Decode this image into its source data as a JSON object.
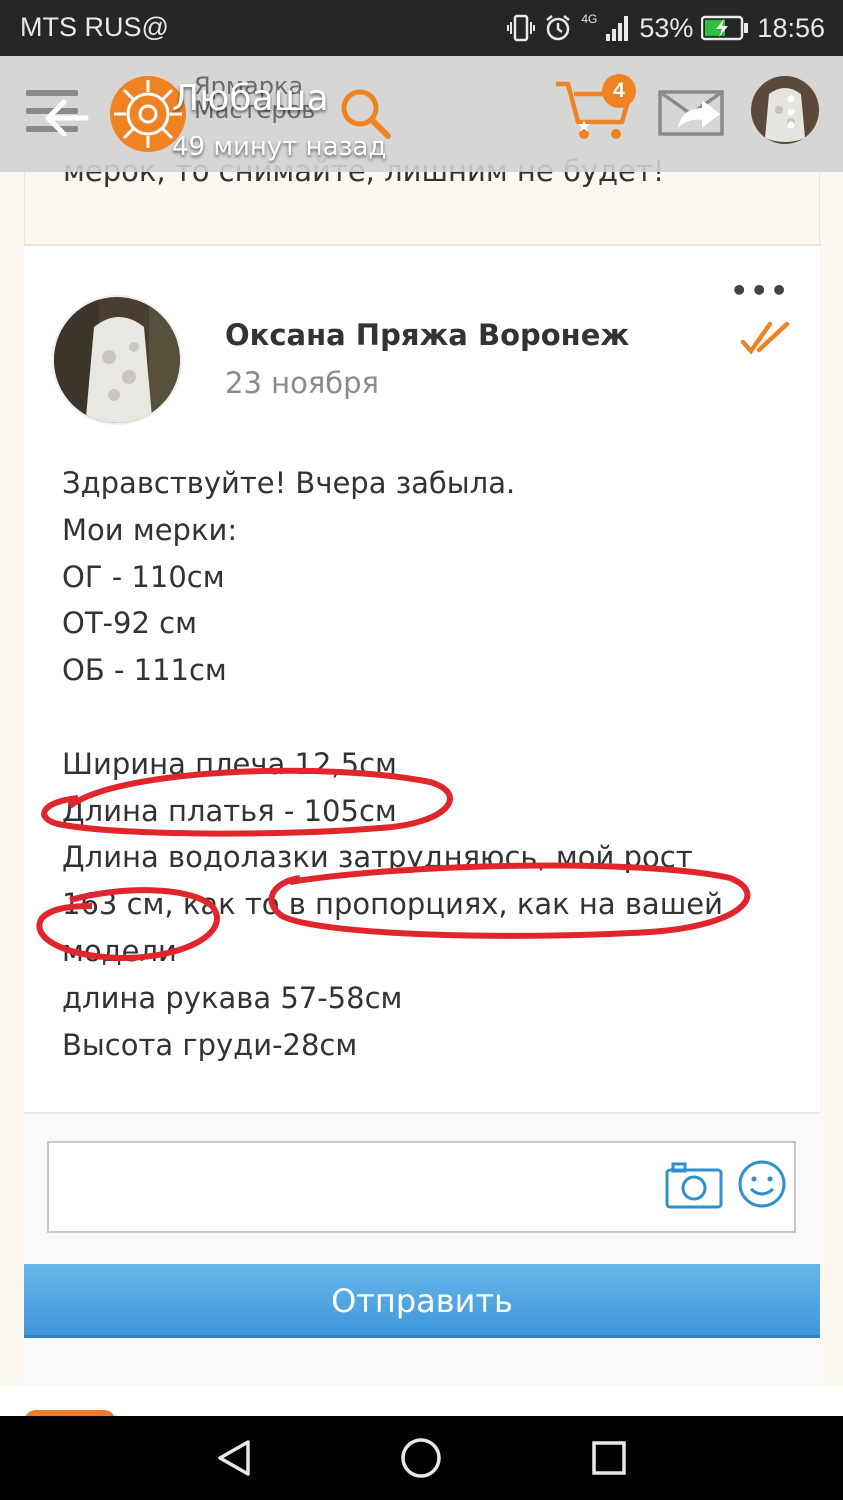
{
  "status_bar": {
    "carrier": "MTS RUS",
    "network": "4G",
    "battery": "53%",
    "time": "18:56"
  },
  "header": {
    "logo_lines": [
      "Ярмарка",
      "Мастеров"
    ],
    "chat_name": "Любаша",
    "chat_status": "49 минут назад",
    "cart_count": "4",
    "brand_color": "#ef8223"
  },
  "previous_message": {
    "text": "мерок, то снимайте, лишним не будет!"
  },
  "message": {
    "author": "Оксана Пряжа Воронеж",
    "date": "23 ноября",
    "more": "•••",
    "lines": [
      "Здравствуйте! Вчера забыла.",
      "Мои мерки:",
      "ОГ - 110см",
      "ОТ-92 см",
      "ОБ - 111см",
      "",
      "Ширина плеча 12,5см",
      "Длина платья - 105см",
      "Длина водолазки затрудняюсь, мой рост",
      "163 см, как то в пропорциях, как на вашей",
      "модели",
      "длина рукава 57-58см",
      "Высота груди-28см"
    ]
  },
  "composer": {
    "placeholder": "",
    "send_label": "Отправить",
    "accent": "#3f97d9"
  }
}
